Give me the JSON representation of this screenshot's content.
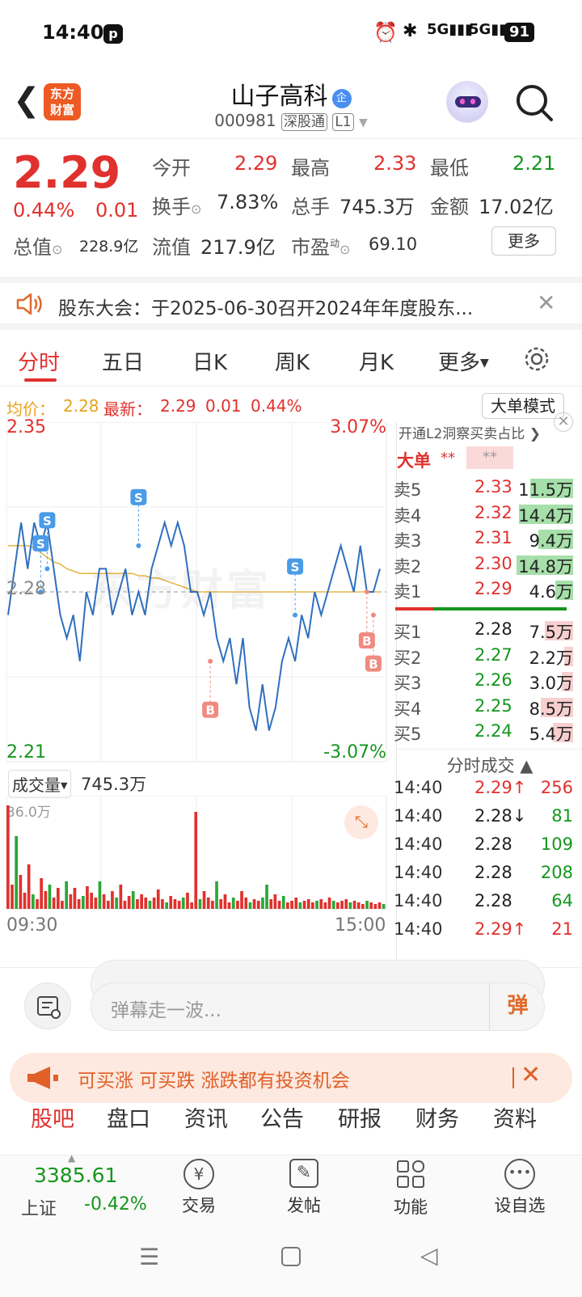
{
  "status": {
    "time": "14:40",
    "battery": "91",
    "network": "5G"
  },
  "header": {
    "back": "back-icon",
    "logo_l1": "东方",
    "logo_l2": "财富",
    "name": "山子高科",
    "name_badge": "企",
    "code": "000981",
    "tag1": "深股通",
    "tag2": "L1"
  },
  "quote": {
    "price": "2.29",
    "pct": "0.44%",
    "chg": "0.01",
    "open_l": "今开",
    "open_v": "2.29",
    "high_l": "最高",
    "high_v": "2.33",
    "low_l": "最低",
    "low_v": "2.21",
    "turn_l": "换手",
    "turn_v": "7.83%",
    "vol_l": "总手",
    "vol_v": "745.3万",
    "amt_l": "金额",
    "amt_v": "17.02亿",
    "mcap_l": "总值",
    "mcap_v": "228.9亿",
    "fcap_l": "流值",
    "fcap_v": "217.9亿",
    "pe_l": "市盈",
    "pe_sup": "动",
    "pe_v": "69.10",
    "more": "更多"
  },
  "notice": {
    "text": "股东大会：于2025-06-30召开2024年年度股东..."
  },
  "tabs": [
    "分时",
    "五日",
    "日K",
    "周K",
    "月K",
    "更多"
  ],
  "infoline": {
    "avg_l": "均价：",
    "avg_v": "2.28",
    "new_l": "最新：",
    "new_v": "2.29",
    "chg": "0.01",
    "pct": "0.44%",
    "mode": "大单模式"
  },
  "chart_data": {
    "type": "line",
    "title": "",
    "y_top": "2.35",
    "y_bottom": "2.21",
    "y_mid": "2.28",
    "pct_top": "3.07%",
    "pct_bottom": "-3.07%",
    "ylim": [
      2.21,
      2.35
    ],
    "x_start": "09:30",
    "x_end": "15:00",
    "price": [
      2.27,
      2.29,
      2.31,
      2.29,
      2.31,
      2.3,
      2.31,
      2.29,
      2.27,
      2.26,
      2.27,
      2.25,
      2.28,
      2.27,
      2.29,
      2.29,
      2.27,
      2.28,
      2.29,
      2.27,
      2.28,
      2.27,
      2.29,
      2.3,
      2.31,
      2.3,
      2.31,
      2.3,
      2.28,
      2.28,
      2.27,
      2.28,
      2.26,
      2.25,
      2.26,
      2.24,
      2.26,
      2.23,
      2.22,
      2.24,
      2.22,
      2.23,
      2.25,
      2.26,
      2.25,
      2.27,
      2.26,
      2.28,
      2.27,
      2.28,
      2.29,
      2.3,
      2.29,
      2.28,
      2.3,
      2.28,
      2.28,
      2.29
    ],
    "avg": [
      2.3,
      2.3,
      2.3,
      2.3,
      2.299,
      2.297,
      2.295,
      2.293,
      2.292,
      2.29,
      2.289,
      2.288,
      2.288,
      2.288,
      2.288,
      2.288,
      2.288,
      2.288,
      2.288,
      2.288,
      2.287,
      2.287,
      2.286,
      2.286,
      2.285,
      2.284,
      2.283,
      2.282,
      2.281,
      2.28,
      2.28,
      2.28,
      2.28,
      2.28,
      2.28,
      2.28,
      2.28,
      2.28,
      2.28,
      2.28,
      2.28,
      2.28,
      2.28,
      2.28,
      2.28,
      2.28,
      2.28,
      2.28,
      2.28,
      2.28,
      2.28,
      2.28,
      2.28,
      2.28,
      2.28,
      2.28,
      2.28,
      2.28
    ],
    "markers": [
      {
        "label": "S",
        "idx": 5,
        "price": 2.28
      },
      {
        "label": "S",
        "idx": 6,
        "price": 2.29
      },
      {
        "label": "S",
        "idx": 20,
        "price": 2.3
      },
      {
        "label": "S",
        "idx": 44,
        "price": 2.27
      },
      {
        "label": "B",
        "idx": 31,
        "price": 2.25
      },
      {
        "label": "B",
        "idx": 55,
        "price": 2.28
      },
      {
        "label": "B",
        "idx": 56,
        "price": 2.27
      }
    ],
    "watermark": "东方财富"
  },
  "volume": {
    "label": "成交量",
    "total": "745.3万",
    "max": "36.0万",
    "start": "09:30",
    "end": "15:00"
  },
  "orderbook": {
    "title": "开通L2洞察买卖占比",
    "big_l": "大单",
    "big_v1": "**",
    "big_v2": "**",
    "asks": [
      {
        "l": "卖5",
        "p": "2.33",
        "v": "11.5万",
        "bar": 0.44,
        "c": "red"
      },
      {
        "l": "卖4",
        "p": "2.32",
        "v": "14.4万",
        "bar": 0.56,
        "c": "red"
      },
      {
        "l": "卖3",
        "p": "2.31",
        "v": "9.4万",
        "bar": 0.36,
        "c": "red"
      },
      {
        "l": "卖2",
        "p": "2.30",
        "v": "14.8万",
        "bar": 0.58,
        "c": "red"
      },
      {
        "l": "卖1",
        "p": "2.29",
        "v": "4.6万",
        "bar": 0.18,
        "c": "red"
      }
    ],
    "bids": [
      {
        "l": "买1",
        "p": "2.28",
        "v": "7.5万",
        "bar": 0.29,
        "c": "black"
      },
      {
        "l": "买2",
        "p": "2.27",
        "v": "2.2万",
        "bar": 0.09,
        "c": "green"
      },
      {
        "l": "买3",
        "p": "2.26",
        "v": "3.0万",
        "bar": 0.12,
        "c": "green"
      },
      {
        "l": "买4",
        "p": "2.25",
        "v": "8.5万",
        "bar": 0.33,
        "c": "green"
      },
      {
        "l": "买5",
        "p": "2.24",
        "v": "5.4万",
        "bar": 0.21,
        "c": "green"
      }
    ],
    "ticks_title": "分时成交",
    "ticks": [
      {
        "t": "14:40",
        "p": "2.29",
        "a": "↑",
        "v": "256",
        "pc": "red",
        "vc": "red"
      },
      {
        "t": "14:40",
        "p": "2.28",
        "a": "↓",
        "v": "81",
        "pc": "black",
        "vc": "green"
      },
      {
        "t": "14:40",
        "p": "2.28",
        "a": "",
        "v": "109",
        "pc": "black",
        "vc": "green"
      },
      {
        "t": "14:40",
        "p": "2.28",
        "a": "",
        "v": "208",
        "pc": "black",
        "vc": "green"
      },
      {
        "t": "14:40",
        "p": "2.28",
        "a": "",
        "v": "64",
        "pc": "black",
        "vc": "green"
      },
      {
        "t": "14:40",
        "p": "2.29",
        "a": "↑",
        "v": "21",
        "pc": "red",
        "vc": "red"
      }
    ]
  },
  "danmu": {
    "placeholder": "弹幕走一波...",
    "send": "弹"
  },
  "promo": {
    "text": "可买涨 可买跌 涨跌都有投资机会"
  },
  "subtabs": [
    "股吧",
    "盘口",
    "资讯",
    "公告",
    "研报",
    "财务",
    "资料"
  ],
  "nav": {
    "index_v": "3385.61",
    "index_l": "上证",
    "index_pct": "-0.42%",
    "items": [
      "交易",
      "发帖",
      "功能",
      "设自选"
    ]
  }
}
